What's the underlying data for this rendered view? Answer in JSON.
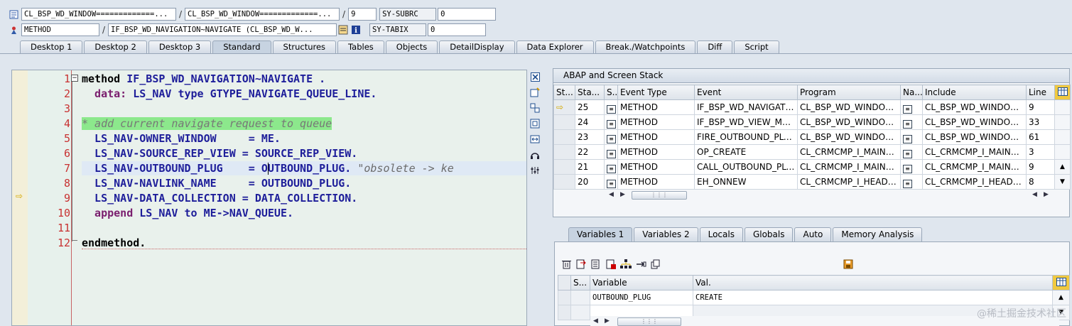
{
  "header": {
    "row1": {
      "program": "CL_BSP_WD_WINDOW=============...",
      "include": "CL_BSP_WD_WINDOW=============...",
      "line": "9",
      "sysfield": "SY-SUBRC",
      "sysvalue": "0"
    },
    "row2": {
      "type": "METHOD",
      "name": "IF_BSP_WD_NAVIGATION~NAVIGATE (CL_BSP_WD_W...",
      "sysfield": "SY-TABIX",
      "sysvalue": "0"
    },
    "separator": "/"
  },
  "tabs": [
    "Desktop 1",
    "Desktop 2",
    "Desktop 3",
    "Standard",
    "Structures",
    "Tables",
    "Objects",
    "DetailDisplay",
    "Data Explorer",
    "Break./Watchpoints",
    "Diff",
    "Script"
  ],
  "active_tab": "Standard",
  "editor": {
    "line_numbers": [
      "1",
      "2",
      "3",
      "4",
      "5",
      "6",
      "7",
      "8",
      "9",
      "10",
      "11",
      "12"
    ],
    "current_line_marker": "⇨",
    "lines": [
      {
        "a": "method ",
        "b": "IF_BSP_WD_NAVIGATION~NAVIGATE .",
        "c": ""
      },
      {
        "a": "  data: ",
        "b": "LS_NAV ",
        "c": "type GTYPE_NAVIGATE_QUEUE_LINE."
      },
      {
        "a": "",
        "b": "",
        "c": ""
      },
      {
        "a": "* add current navigate request to queue",
        "b": "",
        "c": ""
      },
      {
        "a": "  LS_NAV-OWNER_WINDOW     = ",
        "b": "ME.",
        "c": ""
      },
      {
        "a": "  LS_NAV-SOURCE_REP_VIEW = ",
        "b": "SOURCE_REP_VIEW.",
        "c": ""
      },
      {
        "a": "  LS_NAV-OUTBOUND_PLUG    = ",
        "b": "OUTBOUND_PLUG. ",
        "c": "\"obsolete -> ke"
      },
      {
        "a": "  LS_NAV-NAVLINK_NAME     = ",
        "b": "OUTBOUND_PLUG.",
        "c": ""
      },
      {
        "a": "  LS_NAV-DATA_COLLECTION = ",
        "b": "DATA_COLLECTION.",
        "c": ""
      },
      {
        "a": "  append ",
        "b": "LS_NAV to ",
        "c": "ME->NAV_QUEUE."
      },
      {
        "a": "",
        "b": "",
        "c": ""
      },
      {
        "a": "endmethod.",
        "b": "",
        "c": ""
      }
    ]
  },
  "stack": {
    "title": "ABAP and Screen Stack",
    "columns": [
      "St...",
      "Sta...",
      "S...",
      "Event Type",
      "Event",
      "Program",
      "Na...",
      "Include",
      "Line"
    ],
    "rows": [
      {
        "marker": "⇨",
        "level": "25",
        "type": "METHOD",
        "event": "IF_BSP_WD_NAVIGATIO...",
        "program": "CL_BSP_WD_WINDOW=...",
        "include": "CL_BSP_WD_WINDOW=...",
        "line": "9"
      },
      {
        "marker": "",
        "level": "24",
        "type": "METHOD",
        "event": "IF_BSP_WD_VIEW_MAN...",
        "program": "CL_BSP_WD_WINDOW=...",
        "include": "CL_BSP_WD_WINDOW=...",
        "line": "33"
      },
      {
        "marker": "",
        "level": "23",
        "type": "METHOD",
        "event": "FIRE_OUTBOUND_PLUG",
        "program": "CL_BSP_WD_WINDOW=...",
        "include": "CL_BSP_WD_WINDOW=...",
        "line": "61"
      },
      {
        "marker": "",
        "level": "22",
        "type": "METHOD",
        "event": "OP_CREATE",
        "program": "CL_CRMCMP_I_MAINWIN...",
        "include": "CL_CRMCMP_I_MAINWIN...",
        "line": "3"
      },
      {
        "marker": "",
        "level": "21",
        "type": "METHOD",
        "event": "CALL_OUTBOUND_PLUG",
        "program": "CL_CRMCMP_I_MAINWIN...",
        "include": "CL_CRMCMP_I_MAINWIN...",
        "line": "9"
      },
      {
        "marker": "",
        "level": "20",
        "type": "METHOD",
        "event": "EH_ONNEW",
        "program": "CL_CRMCMP_I_HEADERR...",
        "include": "CL_CRMCMP_I_HEADERR...",
        "line": "8"
      }
    ]
  },
  "var_tabs": [
    "Variables 1",
    "Variables 2",
    "Locals",
    "Globals",
    "Auto",
    "Memory Analysis"
  ],
  "active_var_tab": "Variables 1",
  "variables": {
    "columns": [
      "S...",
      "Variable",
      "Val."
    ],
    "rows": [
      {
        "variable": "OUTBOUND_PLUG",
        "value": "CREATE"
      },
      {
        "variable": "",
        "value": ""
      }
    ]
  },
  "watermark": "@稀土掘金技术社区"
}
